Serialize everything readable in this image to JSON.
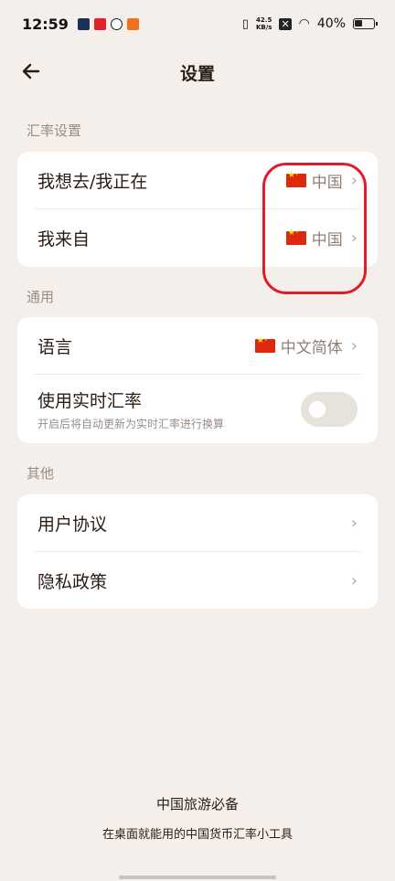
{
  "status_bar": {
    "time": "12:59",
    "net_speed_value": "42.5",
    "net_speed_unit": "KB/s",
    "battery_percent": "40%",
    "app_icons": [
      "play-icon",
      "taobao-icon",
      "link-icon",
      "app-icon"
    ],
    "colors": [
      "#1a2f5a",
      "#e2232a",
      "#1a1a1a",
      "#f07020"
    ]
  },
  "header": {
    "title": "设置"
  },
  "sections": {
    "exchange": {
      "label": "汇率设置",
      "rows": [
        {
          "label": "我想去/我正在",
          "value": "中国"
        },
        {
          "label": "我来自",
          "value": "中国"
        }
      ]
    },
    "general": {
      "label": "通用",
      "language": {
        "label": "语言",
        "value": "中文简体"
      },
      "realtime": {
        "label": "使用实时汇率",
        "sub": "开启后将自动更新为实时汇率进行换算",
        "enabled": false
      }
    },
    "other": {
      "label": "其他",
      "rows": [
        {
          "label": "用户协议"
        },
        {
          "label": "隐私政策"
        }
      ]
    }
  },
  "footer": {
    "title": "中国旅游必备",
    "subtitle": "在桌面就能用的中国货币汇率小工具"
  },
  "icons": {
    "chevron": "›",
    "flag": "china-flag-icon"
  },
  "accent_color": "#e21b2a"
}
